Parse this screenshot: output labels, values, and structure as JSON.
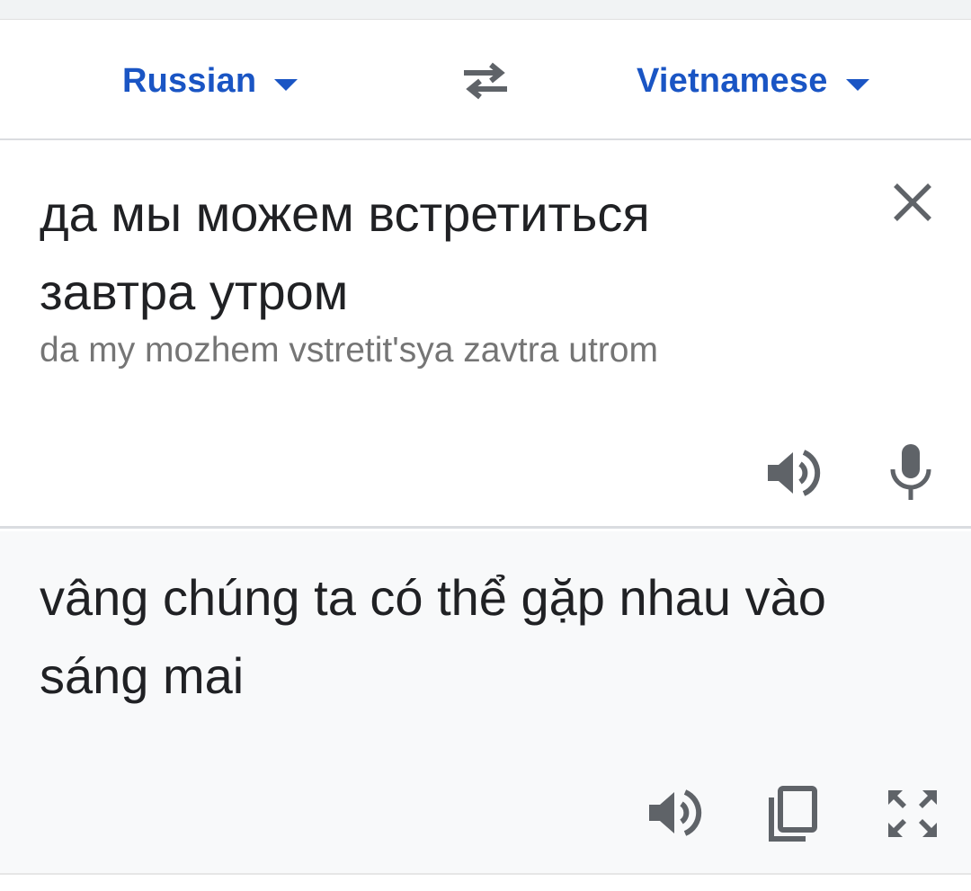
{
  "language_bar": {
    "source_language": "Russian",
    "target_language": "Vietnamese",
    "swap_icon": "swap-arrows-icon",
    "dropdown_icon": "caret-down-icon"
  },
  "source": {
    "text": "да мы можем встретиться завтра утром",
    "transliteration": "da my mozhem vstretit'sya zavtra utrom",
    "clear_icon": "close-icon",
    "speak_icon": "speaker-icon",
    "mic_icon": "microphone-icon"
  },
  "translation": {
    "text": "vâng chúng ta có thể gặp nhau vào sáng mai",
    "speak_icon": "speaker-icon",
    "copy_icon": "copy-icon",
    "fullscreen_icon": "fullscreen-icon"
  },
  "colors": {
    "accent": "#1a55c4",
    "text_primary": "#202124",
    "text_secondary": "#757575",
    "icon": "#5f6368",
    "translation_background": "#f8f9fa",
    "divider": "#dadce0"
  }
}
